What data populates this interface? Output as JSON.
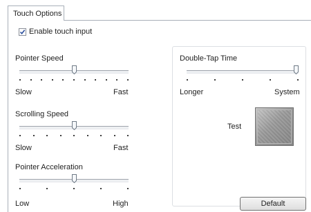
{
  "tab": {
    "label": "Touch Options"
  },
  "enable_touch": {
    "label": "Enable touch input",
    "checked": true
  },
  "pointer_speed": {
    "title": "Pointer Speed",
    "min_label": "Slow",
    "max_label": "Fast",
    "value": 0.5,
    "ticks": 11
  },
  "scrolling_speed": {
    "title": "Scrolling Speed",
    "min_label": "Slow",
    "max_label": "Fast",
    "value": 0.5,
    "ticks": 9
  },
  "pointer_acceleration": {
    "title": "Pointer Acceleration",
    "min_label": "Low",
    "max_label": "High",
    "value": 0.5,
    "ticks": 5
  },
  "double_tap": {
    "title": "Double-Tap Time",
    "min_label": "Longer",
    "max_label": "System",
    "value": 1.0,
    "ticks": 5,
    "test_label": "Test"
  },
  "buttons": {
    "default_label": "Default"
  }
}
